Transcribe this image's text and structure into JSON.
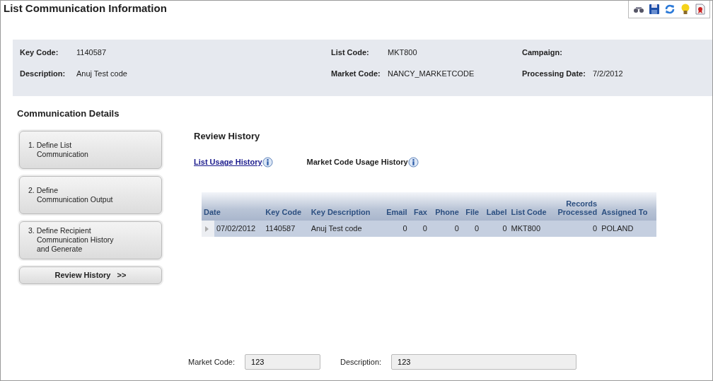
{
  "window": {
    "title": "List Communication Information"
  },
  "header_fields": [
    {
      "label": "Key Code:",
      "value": "1140587"
    },
    {
      "label": "List Code:",
      "value": "MKT800"
    },
    {
      "label": "Campaign:"
    },
    {
      "label": "Description:",
      "value": "Anuj Test code"
    },
    {
      "label": "Market Code:",
      "value": "NANCY_MARKETCODE"
    },
    {
      "label": "Processing Date:",
      "value": "7/2/2012"
    }
  ],
  "section_title": "Communication Details",
  "steps": [
    {
      "lines": [
        "1. Define List",
        "Communication"
      ],
      "selected": false
    },
    {
      "lines": [
        "2. Define",
        "Communication Output"
      ],
      "selected": false
    },
    {
      "lines": [
        "3. Define Recipient",
        "Communication History",
        "and Generate"
      ],
      "selected": false
    },
    {
      "lines": [
        "Review History   >>"
      ],
      "selected": true
    }
  ],
  "review_title": "Review History",
  "history_links": [
    {
      "label": "List Usage History",
      "kind": "link"
    },
    {
      "label": "Market Code Usage History",
      "kind": "text"
    }
  ],
  "table": {
    "columns": [
      {
        "label": "Date",
        "kind": "text"
      },
      {
        "label": "Key Code",
        "kind": "text"
      },
      {
        "label": "Key Description",
        "kind": "text"
      },
      {
        "label": "Email",
        "kind": "number"
      },
      {
        "label": "Fax",
        "kind": "number"
      },
      {
        "label": "Phone",
        "kind": "number"
      },
      {
        "label": "File",
        "kind": "number"
      },
      {
        "label": "Label",
        "kind": "number"
      },
      {
        "label": "List Code",
        "kind": "text"
      },
      {
        "label": "Records Processed",
        "kind": "number"
      },
      {
        "label": "Assigned To",
        "kind": "text"
      }
    ],
    "rows": [
      {
        "cells": [
          "07/02/2012",
          "1140587",
          "Anuj Test code",
          "0",
          "0",
          "0",
          "0",
          "0",
          "MKT800",
          "0",
          "POLAND"
        ],
        "expanded": false
      }
    ]
  },
  "footer_fields": [
    {
      "label": "Market Code:",
      "value": "123"
    },
    {
      "label": "Description:",
      "value": "123"
    }
  ]
}
